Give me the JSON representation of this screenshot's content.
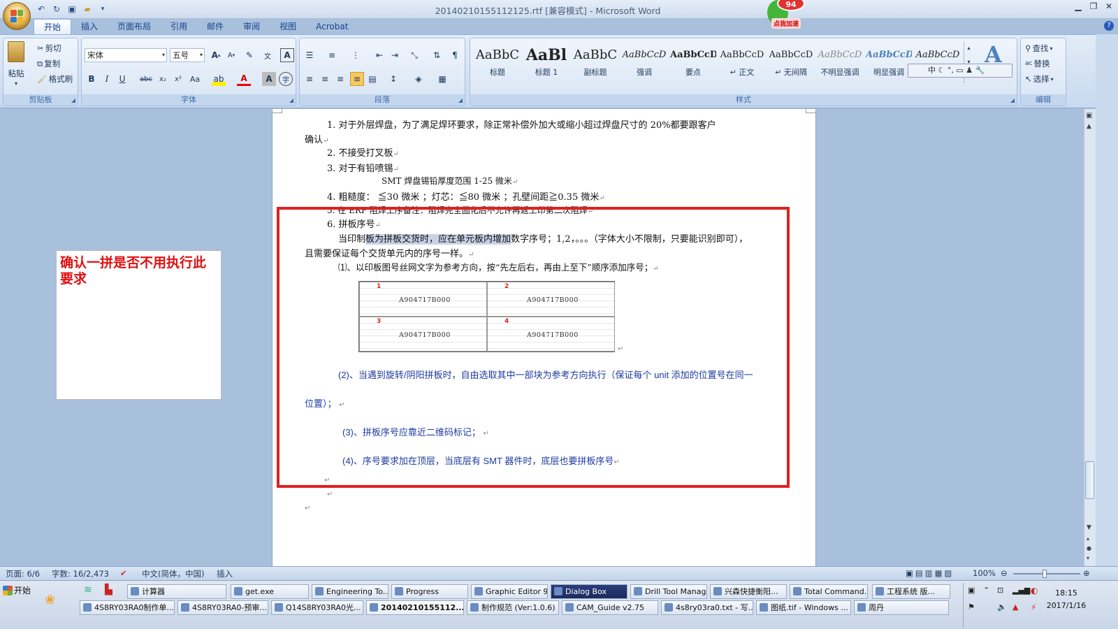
{
  "window": {
    "title": "20140210155112125.rtf [兼容模式] - Microsoft Word"
  },
  "frog_badge": {
    "count": "94",
    "label": "点我加速"
  },
  "tabs": [
    "开始",
    "插入",
    "页面布局",
    "引用",
    "邮件",
    "审阅",
    "视图",
    "Acrobat"
  ],
  "ribbon": {
    "clipboard": {
      "paste": "粘贴",
      "cut": "剪切",
      "copy": "复制",
      "format_painter": "格式刷",
      "label": "剪贴板"
    },
    "font": {
      "name": "宋体",
      "size": "五号",
      "label": "字体"
    },
    "paragraph": {
      "label": "段落"
    },
    "styles": {
      "label": "样式",
      "items": [
        {
          "preview": "AaBbC",
          "name": "标题"
        },
        {
          "preview": "AaBl",
          "name": "标题 1"
        },
        {
          "preview": "AaBbC",
          "name": "副标题"
        },
        {
          "preview": "AaBbCcD",
          "name": "强调"
        },
        {
          "preview": "AaBbCcD",
          "name": "要点"
        },
        {
          "preview": "AaBbCcD",
          "name": "↵ 正文"
        },
        {
          "preview": "AaBbCcD",
          "name": "↵ 无间隔"
        },
        {
          "preview": "AaBbCcD",
          "name": "不明显强调"
        },
        {
          "preview": "AaBbCcD",
          "name": "明显强调"
        },
        {
          "preview": "AaBbCcD",
          "name": ""
        }
      ]
    },
    "editing": {
      "find": "查找",
      "replace": "替换",
      "select": "选择",
      "label": "编辑"
    },
    "ime_bar": "中"
  },
  "document": {
    "item1a": "1. 对于外层焊盘，为了满足焊环要求，除正常补偿外加大或缩小超过焊盘尺寸的 20%都要跟客户",
    "item1b": "确认",
    "item2": "2. 不接受打叉板",
    "item3": "3.  对于有铅喷锡",
    "item3sub": "SMT 焊盘锡铅厚度范围 1-25 微米",
    "item4": "4.  粗糙度： ≦30 微米  ；灯芯：≦80 微米 ；孔壁间距≧0.35 微米",
    "item5": "5.  在 ERP 阻焊工序备注：阻焊完全固化后不允许再返工印第二次阻焊",
    "item6": "6.  拼板序号",
    "para_prefix": "当印制",
    "para_highlight": "板为拼板交货时，应在单元板内增加",
    "para_suffix": "数字序号；1,2，。。。（字体大小不限制，只要能识别即可），",
    "para_line2": "且需要保证每个交货单元内的序号一样。",
    "sub1": "⑴、以印板图号丝网文字为参考方向，按“先左后右，再由上至下”顺序添加序号；",
    "sub2a": "(2)、当遇到旋转/阴阳拼板时，自由选取其中一部块为参考方向执行（保证每个 unit 添加的位置号在同一",
    "sub2b": "位置）；",
    "sub3": "(3)、拼板序号应靠近二维码标记；",
    "sub4": "(4)、序号要求加在顶层，当底层有 SMT 器件时，底层也要拼板序号",
    "panels": [
      {
        "num": "1",
        "code": "A904717B000"
      },
      {
        "num": "2",
        "code": "A904717B000"
      },
      {
        "num": "3",
        "code": "A904717B000"
      },
      {
        "num": "4",
        "code": "A904717B000"
      }
    ]
  },
  "comment": {
    "text": "确认一拼是否不用执行此要求"
  },
  "status": {
    "page": "页面: 6/6",
    "words": "字数: 16/2,473",
    "lang": "中文(简体，中国)",
    "mode": "插入",
    "zoom": "100%"
  },
  "taskbar": {
    "start": "开始",
    "row1": [
      "计算器",
      "get.exe",
      "Engineering To...",
      "Progress",
      "Graphic Editor 9...",
      "Dialog Box",
      "Drill Tool Manager",
      "兴森快捷衡阳...",
      "Total Command...",
      "工程系统  版..."
    ],
    "row2": [
      "4S8RY03RA0制作单...",
      "4S8RY03RA0-预审...",
      "Q14S8RY03RA0光...",
      "20140210155112...",
      "制作规范 (Ver:1.0.6)",
      "CAM_Guide v2.75",
      "4s8ry03ra0.txt - 写...",
      "图纸.tif - Windows ...",
      "周丹"
    ],
    "time": "18:15",
    "date": "2017/1/16"
  }
}
